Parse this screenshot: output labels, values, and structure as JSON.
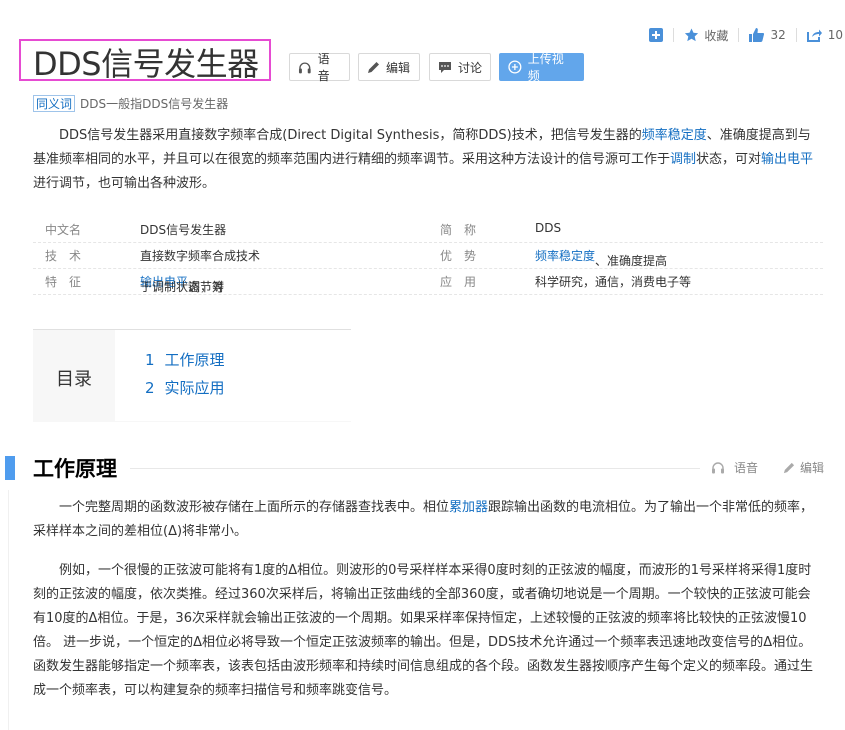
{
  "header": {
    "title": "DDS信号发生器",
    "buttons": {
      "voice": "语音",
      "edit": "编辑",
      "discuss": "讨论",
      "upload_video": "上传视频"
    },
    "actions": {
      "favorite": "收藏",
      "like_count": "32",
      "share_count": "10"
    }
  },
  "synonym": {
    "tag": "同义词",
    "text": "DDS一般指DDS信号发生器"
  },
  "summary": {
    "p1": "DDS信号发生器采用直接数字频率合成(Direct Digital Synthesis，简称DDS)技术，把信号发生器的",
    "link1": "频率稳定度",
    "p2": "、准确度提高到与基准频率相同的水平，并且可以在很宽的频率范围内进行精细的频率调节。采用这种方法设计的信号源可工作于",
    "link2": "调制",
    "p3": "状态，可对",
    "link3": "输出电平",
    "p4": "进行调节，也可输出各种波形。"
  },
  "info": {
    "row1": {
      "k1": "中文名",
      "v1": "DDS信号发生器",
      "k2": "简　称",
      "v2": "DDS"
    },
    "row2": {
      "k1": "技　术",
      "v1": "直接数字频率合成技术",
      "k2": "优　势",
      "v2_link": "频率稳定度",
      "v2_rest": "、准确度提高"
    },
    "row3": {
      "k1": "特　征",
      "v1_a": "于调制状态，对",
      "v1_link": "输出电平",
      "v1_b": "调节等",
      "k2": "应　用",
      "v2": "科学研究，通信，消费电子等"
    }
  },
  "toc": {
    "label": "目录",
    "items": [
      {
        "num": "1",
        "label": "工作原理"
      },
      {
        "num": "2",
        "label": "实际应用"
      }
    ]
  },
  "section1": {
    "title": "工作原理",
    "voice": "语音",
    "edit": "编辑",
    "para1_a": "一个完整周期的函数波形被存储在上面所示的存储器查找表中。相位",
    "para1_link": "累加器",
    "para1_b": "跟踪输出函数的电流相位。为了输出一个非常低的频率，采样样本之间的差相位(Δ)将非常小。",
    "para2": "例如，一个很慢的正弦波可能将有1度的Δ相位。则波形的0号采样样本采得0度时刻的正弦波的幅度，而波形的1号采样将采得1度时刻的正弦波的幅度，依次类推。经过360次采样后，将输出正弦曲线的全部360度，或者确切地说是一个周期。一个较快的正弦波可能会有10度的Δ相位。于是，36次采样就会输出正弦波的一个周期。如果采样率保持恒定，上述较慢的正弦波的频率将比较快的正弦波慢10倍。 进一步说，一个恒定的Δ相位必将导致一个恒定正弦波频率的输出。但是，DDS技术允许通过一个频率表迅速地改变信号的Δ相位。函数发生器能够指定一个频率表，该表包括由波形频率和持续时间信息组成的各个段。函数发生器按顺序产生每个定义的频率段。通过生成一个频率表，可以构建复杂的频率扫描信号和频率跳变信号。"
  },
  "colors": {
    "link": "#136ec2",
    "primary_button": "#62a6eb",
    "section_bar": "#4f9cee",
    "title_highlight": "#e64bd2"
  }
}
